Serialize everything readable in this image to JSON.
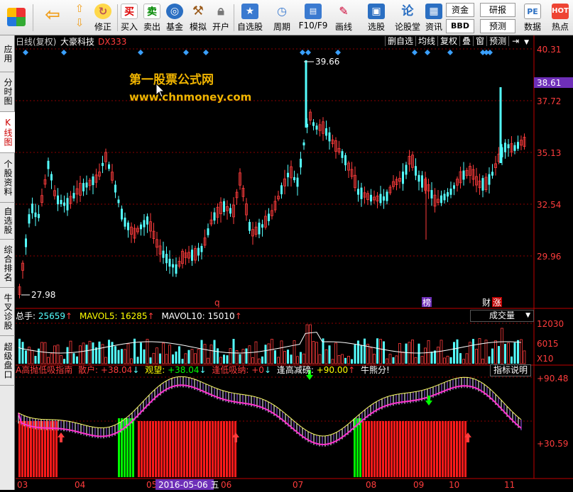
{
  "toolbar": {
    "buttons": [
      {
        "label": "",
        "icon": "app-grid-icon"
      },
      {
        "label": "",
        "icon": "back-arrow-icon"
      },
      {
        "label": "",
        "icon": "up-down-arrows-icon"
      },
      {
        "label": "修正",
        "icon": "refresh-icon"
      },
      {
        "label": "买入",
        "icon": "buy-icon",
        "glyph": "买"
      },
      {
        "label": "卖出",
        "icon": "sell-icon",
        "glyph": "卖"
      },
      {
        "label": "基金",
        "icon": "fund-icon"
      },
      {
        "label": "模拟",
        "icon": "hammer-icon"
      },
      {
        "label": "开户",
        "icon": "lock-icon"
      },
      {
        "label": "自选股",
        "icon": "star-icon"
      },
      {
        "label": "周期",
        "icon": "clock-icon"
      },
      {
        "label": "F10/F9",
        "icon": "f10-icon"
      },
      {
        "label": "画线",
        "icon": "pencil-icon"
      },
      {
        "label": "选股",
        "icon": "screen-icon"
      },
      {
        "label": "论股堂",
        "icon": "forum-icon",
        "glyph": "论"
      },
      {
        "label": "资讯",
        "icon": "news-icon"
      },
      {
        "label": "数据",
        "icon": "pe-icon",
        "glyph": "PE"
      },
      {
        "label": "热点",
        "icon": "hot-icon"
      }
    ],
    "fund_label": "资金",
    "bbd_label": "BBD",
    "research_label": "研报",
    "forecast_label": "预测"
  },
  "sidebar": {
    "items": [
      {
        "label": "应用"
      },
      {
        "label": "分时图"
      },
      {
        "label": "K线图"
      },
      {
        "label": "个股资料"
      },
      {
        "label": "自选股"
      },
      {
        "label": "综合排名"
      },
      {
        "label": "牛叉诊股"
      },
      {
        "label": "超级盘口"
      }
    ]
  },
  "header": {
    "period": "日线(复权)",
    "stock_name": "大豪科技",
    "code": "DX333",
    "buttons": [
      "删自选",
      "均线",
      "复权",
      "叠",
      "窗",
      "预测"
    ]
  },
  "watermark": {
    "title": "第一股票公式网",
    "url": "www.chnmoney.com"
  },
  "price_axis": {
    "labels": [
      "40.31",
      "37.72",
      "35.13",
      "32.54",
      "29.96"
    ],
    "current": "38.61"
  },
  "annotations": {
    "high": "39.66",
    "low": "27.98",
    "q": "q",
    "bang": "榜",
    "cai": "财",
    "zhang": "涨"
  },
  "volume": {
    "prefix": "总手: ",
    "total": "25659",
    "total_arrow": "↑",
    "ma5_label": "MAVOL5: ",
    "ma5": "16285",
    "ma5_arrow": "↑",
    "ma10_label": "MAVOL10: ",
    "ma10": "15010",
    "ma10_arrow": "↑",
    "dropdown": "成交量",
    "axis": [
      "12030",
      "6015"
    ],
    "unit": "X10"
  },
  "indicator": {
    "name": "A高抛低吸指南",
    "s1_label": "散户: ",
    "s1": "+38.04",
    "s1_arrow": "↓",
    "s2_label": "观望: ",
    "s2": "+38.04",
    "s2_arrow": "↓",
    "s3_label": "逢低吸纳: ",
    "s3": "+0",
    "s3_arrow": "↓",
    "s4_label": "逢高减磅: ",
    "s4": "+90.00",
    "s4_arrow": "↑",
    "s5": "牛熊分!",
    "explain": "指标说明",
    "axis": [
      "+90.48",
      "+30.59"
    ]
  },
  "dates": {
    "labels": [
      "03",
      "04",
      "05",
      "06",
      "07",
      "08",
      "09",
      "10",
      "11"
    ],
    "cursor": "2016-05-06 五"
  },
  "colors": {
    "up": "#ff3c3c",
    "down": "#54ffff",
    "accent": "#c00000",
    "highlight": "#6e2fb8"
  }
}
